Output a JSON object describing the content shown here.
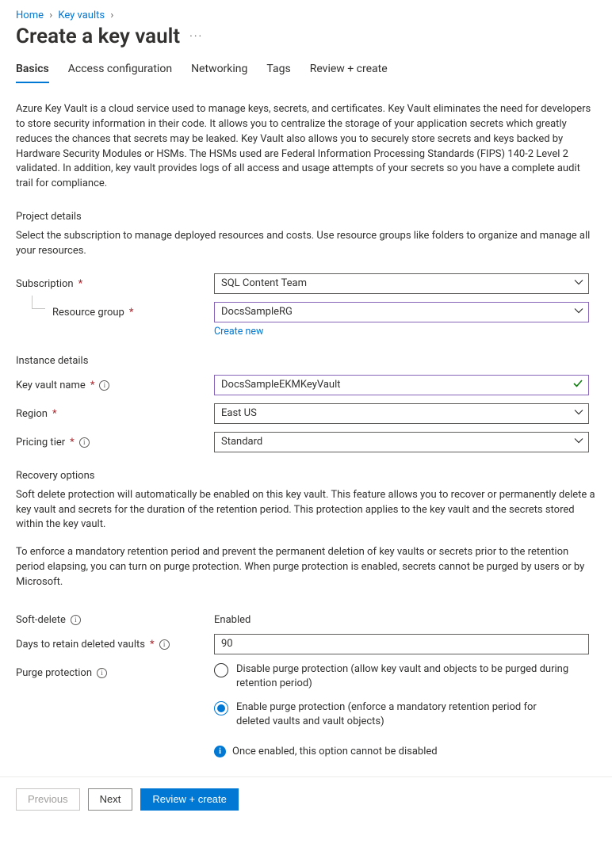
{
  "breadcrumb": {
    "home": "Home",
    "keyvaults": "Key vaults"
  },
  "title": "Create a key vault",
  "tabs": {
    "basics": "Basics",
    "access": "Access configuration",
    "networking": "Networking",
    "tags": "Tags",
    "review": "Review + create"
  },
  "intro": "Azure Key Vault is a cloud service used to manage keys, secrets, and certificates. Key Vault eliminates the need for developers to store security information in their code. It allows you to centralize the storage of your application secrets which greatly reduces the chances that secrets may be leaked. Key Vault also allows you to securely store secrets and keys backed by Hardware Security Modules or HSMs. The HSMs used are Federal Information Processing Standards (FIPS) 140-2 Level 2 validated. In addition, key vault provides logs of all access and usage attempts of your secrets so you have a complete audit trail for compliance.",
  "project": {
    "heading": "Project details",
    "desc": "Select the subscription to manage deployed resources and costs. Use resource groups like folders to organize and manage all your resources.",
    "subscription_label": "Subscription",
    "subscription_value": "SQL Content Team",
    "rg_label": "Resource group",
    "rg_value": "DocsSampleRG",
    "create_new": "Create new"
  },
  "instance": {
    "heading": "Instance details",
    "name_label": "Key vault name",
    "name_value": "DocsSampleEKMKeyVault",
    "region_label": "Region",
    "region_value": "East US",
    "tier_label": "Pricing tier",
    "tier_value": "Standard"
  },
  "recovery": {
    "heading": "Recovery options",
    "p1": "Soft delete protection will automatically be enabled on this key vault. This feature allows you to recover or permanently delete a key vault and secrets for the duration of the retention period. This protection applies to the key vault and the secrets stored within the key vault.",
    "p2": "To enforce a mandatory retention period and prevent the permanent deletion of key vaults or secrets prior to the retention period elapsing, you can turn on purge protection. When purge protection is enabled, secrets cannot be purged by users or by Microsoft.",
    "softdelete_label": "Soft-delete",
    "softdelete_value": "Enabled",
    "days_label": "Days to retain deleted vaults",
    "days_value": "90",
    "purge_label": "Purge protection",
    "purge_opt_disable": "Disable purge protection (allow key vault and objects to be purged during retention period)",
    "purge_opt_enable": "Enable purge protection (enforce a mandatory retention period for deleted vaults and vault objects)",
    "purge_note": "Once enabled, this option cannot be disabled"
  },
  "footer": {
    "previous": "Previous",
    "next": "Next",
    "review": "Review + create"
  }
}
